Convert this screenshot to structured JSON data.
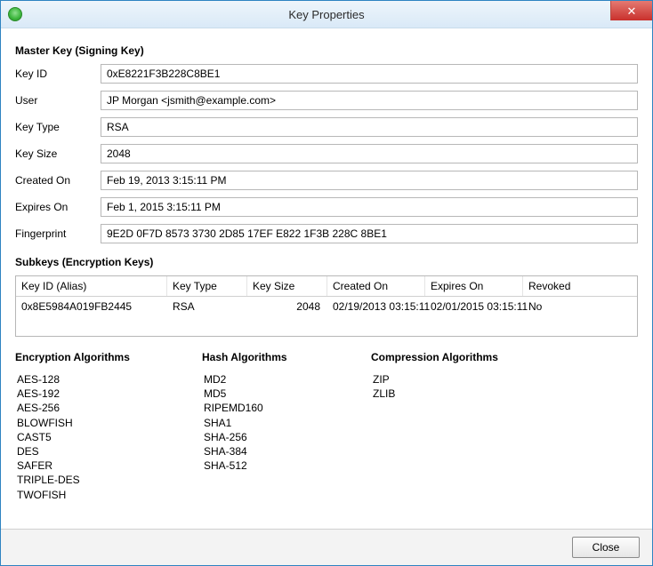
{
  "window": {
    "title": "Key Properties",
    "close_label": "✕"
  },
  "master_key": {
    "heading": "Master Key (Signing Key)",
    "labels": {
      "key_id": "Key ID",
      "user": "User",
      "key_type": "Key Type",
      "key_size": "Key Size",
      "created_on": "Created On",
      "expires_on": "Expires On",
      "fingerprint": "Fingerprint"
    },
    "values": {
      "key_id": "0xE8221F3B228C8BE1",
      "user": "JP Morgan <jsmith@example.com>",
      "key_type": "RSA",
      "key_size": "2048",
      "created_on": "Feb 19, 2013 3:15:11 PM",
      "expires_on": "Feb 1, 2015 3:15:11 PM",
      "fingerprint": "9E2D 0F7D 8573 3730 2D85 17EF E822 1F3B 228C 8BE1"
    }
  },
  "subkeys": {
    "heading": "Subkeys (Encryption Keys)",
    "columns": {
      "key_id_alias": "Key ID (Alias)",
      "key_type": "Key Type",
      "key_size": "Key Size",
      "created_on": "Created On",
      "expires_on": "Expires On",
      "revoked": "Revoked"
    },
    "rows": [
      {
        "key_id_alias": "0x8E5984A019FB2445",
        "key_type": "RSA",
        "key_size": "2048",
        "created_on": "02/19/2013 03:15:11",
        "expires_on": "02/01/2015 03:15:11",
        "revoked": "No"
      }
    ]
  },
  "algorithms": {
    "encryption": {
      "heading": "Encryption Algorithms",
      "items": [
        "AES-128",
        "AES-192",
        "AES-256",
        "BLOWFISH",
        "CAST5",
        "DES",
        "SAFER",
        "TRIPLE-DES",
        "TWOFISH"
      ]
    },
    "hash": {
      "heading": "Hash Algorithms",
      "items": [
        "MD2",
        "MD5",
        "RIPEMD160",
        "SHA1",
        "SHA-256",
        "SHA-384",
        "SHA-512"
      ]
    },
    "compression": {
      "heading": "Compression Algorithms",
      "items": [
        "ZIP",
        "ZLIB"
      ]
    }
  },
  "footer": {
    "close_button": "Close"
  }
}
